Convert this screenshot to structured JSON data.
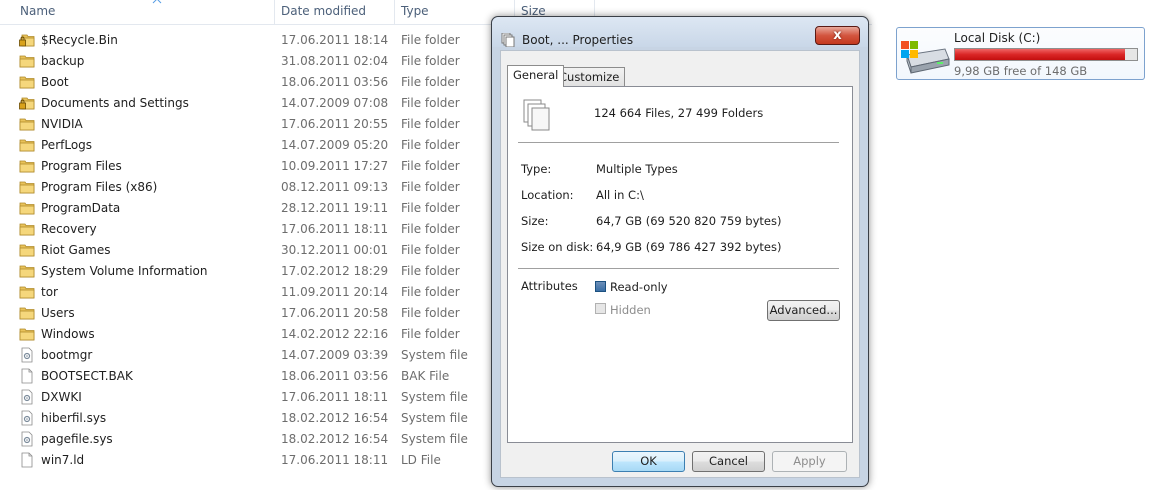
{
  "explorer": {
    "columns": {
      "name": "Name",
      "date": "Date modified",
      "type": "Type",
      "size": "Size"
    },
    "rows": [
      {
        "name": "$Recycle.Bin",
        "date": "17.06.2011 18:14",
        "type": "File folder",
        "icon": "locked-folder-icon"
      },
      {
        "name": "backup",
        "date": "31.08.2011 02:04",
        "type": "File folder",
        "icon": "folder-icon"
      },
      {
        "name": "Boot",
        "date": "18.06.2011 03:56",
        "type": "File folder",
        "icon": "folder-icon"
      },
      {
        "name": "Documents and Settings",
        "date": "14.07.2009 07:08",
        "type": "File folder",
        "icon": "locked-folder-icon"
      },
      {
        "name": "NVIDIA",
        "date": "17.06.2011 20:55",
        "type": "File folder",
        "icon": "folder-icon"
      },
      {
        "name": "PerfLogs",
        "date": "14.07.2009 05:20",
        "type": "File folder",
        "icon": "folder-icon"
      },
      {
        "name": "Program Files",
        "date": "10.09.2011 17:27",
        "type": "File folder",
        "icon": "folder-icon"
      },
      {
        "name": "Program Files (x86)",
        "date": "08.12.2011 09:13",
        "type": "File folder",
        "icon": "folder-icon"
      },
      {
        "name": "ProgramData",
        "date": "28.12.2011 19:11",
        "type": "File folder",
        "icon": "folder-icon"
      },
      {
        "name": "Recovery",
        "date": "17.06.2011 18:11",
        "type": "File folder",
        "icon": "folder-icon"
      },
      {
        "name": "Riot Games",
        "date": "30.12.2011 00:01",
        "type": "File folder",
        "icon": "folder-icon"
      },
      {
        "name": "System Volume Information",
        "date": "17.02.2012 18:29",
        "type": "File folder",
        "icon": "folder-icon"
      },
      {
        "name": "tor",
        "date": "11.09.2011 20:14",
        "type": "File folder",
        "icon": "folder-icon"
      },
      {
        "name": "Users",
        "date": "17.06.2011 20:58",
        "type": "File folder",
        "icon": "folder-icon"
      },
      {
        "name": "Windows",
        "date": "14.02.2012 22:16",
        "type": "File folder",
        "icon": "folder-icon"
      },
      {
        "name": "bootmgr",
        "date": "14.07.2009 03:39",
        "type": "System file",
        "icon": "system-file-icon"
      },
      {
        "name": "BOOTSECT.BAK",
        "date": "18.06.2011 03:56",
        "type": "BAK File",
        "icon": "file-icon"
      },
      {
        "name": "DXWKI",
        "date": "17.06.2011 18:11",
        "type": "System file",
        "icon": "system-file-icon"
      },
      {
        "name": "hiberfil.sys",
        "date": "18.02.2012 16:54",
        "type": "System file",
        "icon": "system-file-icon"
      },
      {
        "name": "pagefile.sys",
        "date": "18.02.2012 16:54",
        "type": "System file",
        "icon": "system-file-icon"
      },
      {
        "name": "win7.ld",
        "date": "17.06.2011 18:11",
        "type": "LD File",
        "icon": "file-icon"
      }
    ]
  },
  "drive": {
    "name": "Local Disk (C:)",
    "free_text": "9,98 GB free of 148 GB",
    "used_fraction": 0.933,
    "bar_color": "#da2626",
    "icon": "hard-drive-icon"
  },
  "dialog": {
    "title": "Boot, ... Properties",
    "close_label": "x",
    "tabs": [
      "General",
      "Customize"
    ],
    "summary": "124 664 Files, 27 499 Folders",
    "fields": [
      {
        "label": "Type:",
        "value": "Multiple Types"
      },
      {
        "label": "Location:",
        "value": "All in C:\\"
      },
      {
        "label": "Size:",
        "value": "64,7 GB (69 520 820 759 bytes)"
      },
      {
        "label": "Size on disk:",
        "value": "64,9 GB (69 786 427 392 bytes)"
      }
    ],
    "attributes_label": "Attributes",
    "readonly_label": "Read-only",
    "hidden_label": "Hidden",
    "advanced_label": "Advanced...",
    "ok_label": "OK",
    "cancel_label": "Cancel",
    "apply_label": "Apply"
  }
}
